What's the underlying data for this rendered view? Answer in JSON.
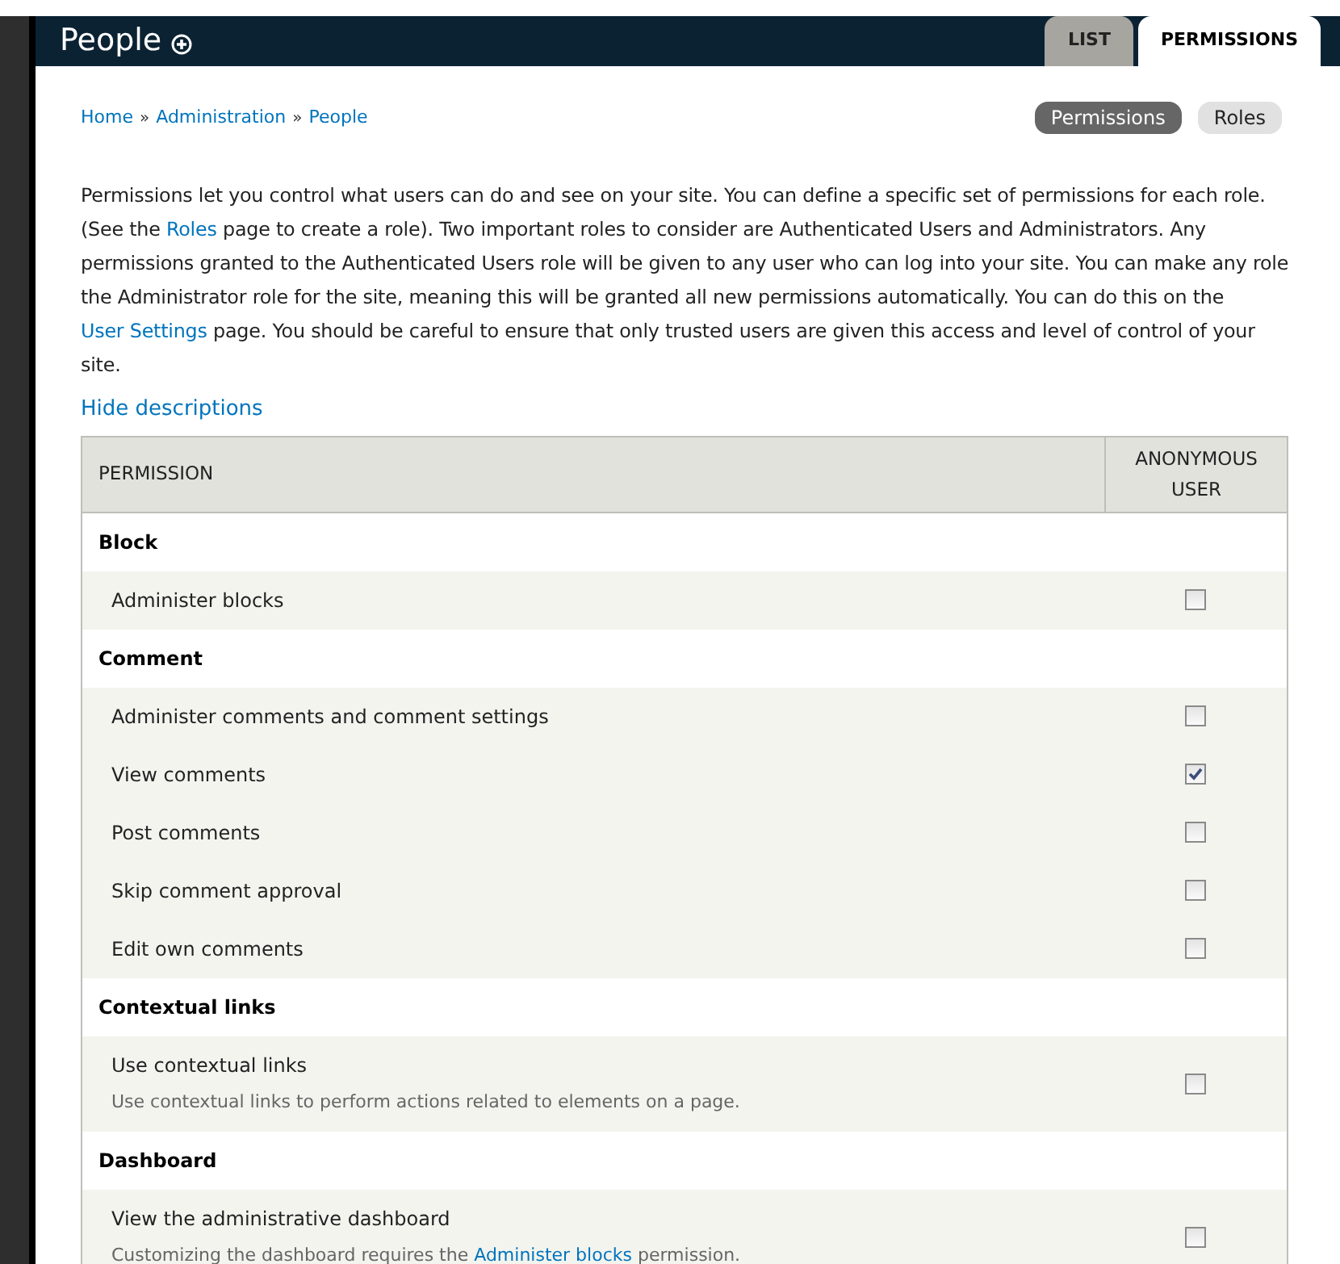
{
  "header": {
    "title": "People",
    "tabs": [
      {
        "label": "LIST",
        "selected": false
      },
      {
        "label": "PERMISSIONS",
        "selected": true
      }
    ]
  },
  "breadcrumb": [
    "Home",
    "Administration",
    "People"
  ],
  "breadcrumb_separator": "»",
  "secondary_tabs": [
    {
      "label": "Permissions",
      "selected": true
    },
    {
      "label": "Roles",
      "selected": false
    }
  ],
  "intro": [
    {
      "kind": "text",
      "text": "Permissions let you control what users can do and see on your site. You can define a specific set of permissions for each role. (See the "
    },
    {
      "kind": "link",
      "text": "Roles"
    },
    {
      "kind": "text",
      "text": " page to create a role). Two important roles to consider are Authenticated Users and Administrators. Any permissions granted to the Authenticated Users role will be given to any user who can log into your site. You can make any role the Administrator role for the site, meaning this will be granted all new permissions automatically. You can do this on the "
    },
    {
      "kind": "link",
      "text": "User Settings"
    },
    {
      "kind": "text",
      "text": " page. You should be careful to ensure that only trusted users are given this access and level of control of your site."
    }
  ],
  "toggle_link": "Hide descriptions",
  "table": {
    "columns": [
      "PERMISSION",
      "ANONYMOUS USER"
    ],
    "rows": [
      {
        "kind": "module",
        "name": "Block"
      },
      {
        "kind": "permission",
        "name": "Administer blocks",
        "checked": false
      },
      {
        "kind": "module",
        "name": "Comment"
      },
      {
        "kind": "permission",
        "name": "Administer comments and comment settings",
        "checked": false
      },
      {
        "kind": "permission",
        "name": "View comments",
        "checked": true
      },
      {
        "kind": "permission",
        "name": "Post comments",
        "checked": false
      },
      {
        "kind": "permission",
        "name": "Skip comment approval",
        "checked": false
      },
      {
        "kind": "permission",
        "name": "Edit own comments",
        "checked": false
      },
      {
        "kind": "module",
        "name": "Contextual links"
      },
      {
        "kind": "permission",
        "name": "Use contextual links",
        "checked": false,
        "description": [
          {
            "kind": "text",
            "text": "Use contextual links to perform actions related to elements on a page."
          }
        ]
      },
      {
        "kind": "module",
        "name": "Dashboard"
      },
      {
        "kind": "permission",
        "name": "View the administrative dashboard",
        "checked": false,
        "description": [
          {
            "kind": "text",
            "text": "Customizing the dashboard requires the "
          },
          {
            "kind": "link",
            "text": "Administer blocks"
          },
          {
            "kind": "text",
            "text": " permission."
          }
        ]
      }
    ]
  }
}
